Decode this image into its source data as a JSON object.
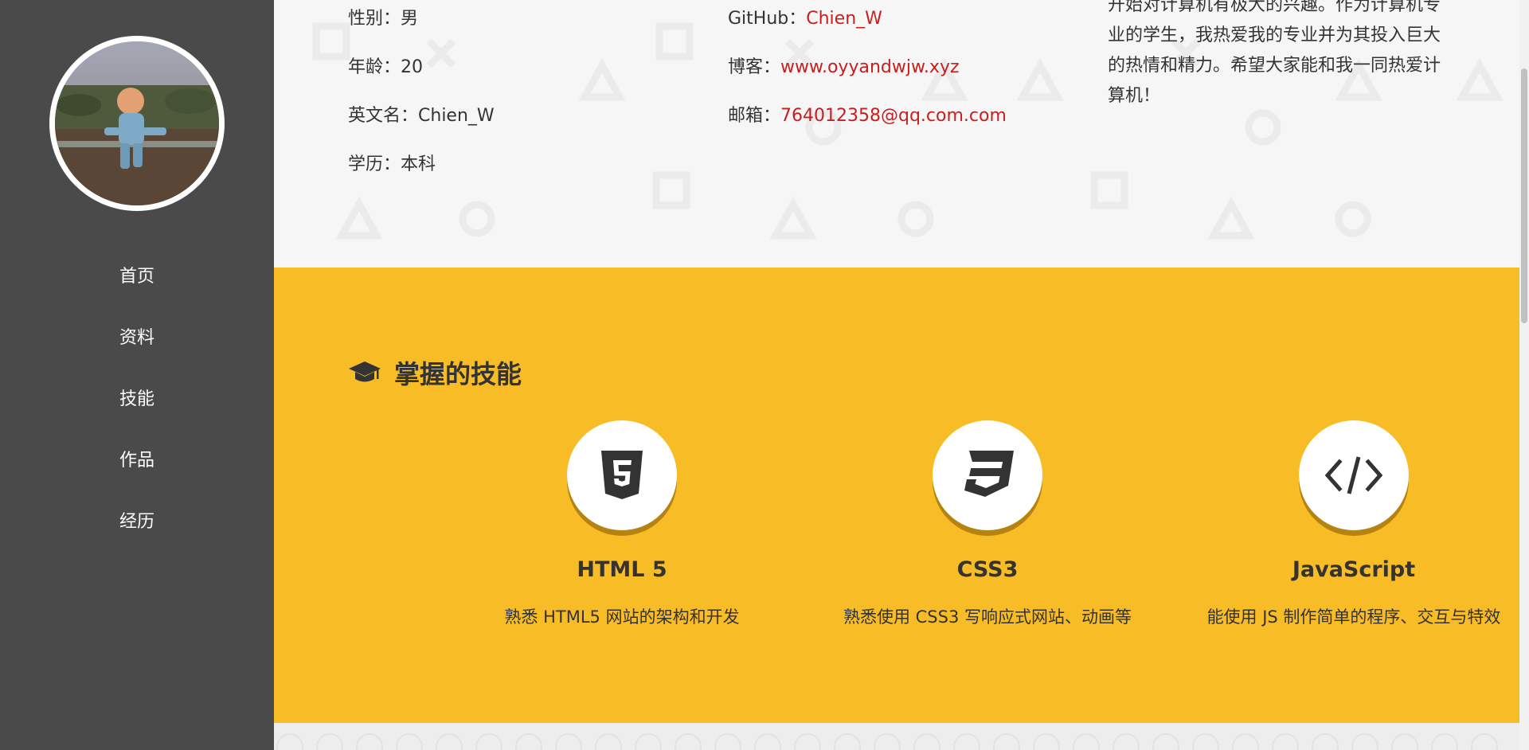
{
  "sidebar": {
    "nav": [
      {
        "label": "首页"
      },
      {
        "label": "资料"
      },
      {
        "label": "技能"
      },
      {
        "label": "作品"
      },
      {
        "label": "经历"
      }
    ]
  },
  "profile": {
    "left": [
      {
        "label": "性别：",
        "value": "男"
      },
      {
        "label": "年龄：",
        "value": "20"
      },
      {
        "label": "英文名：",
        "value": "Chien_W"
      },
      {
        "label": "学历：",
        "value": "本科"
      }
    ],
    "middle": [
      {
        "label": "GitHub：",
        "value": "Chien_W"
      },
      {
        "label": "博客：",
        "value": "www.oyyandwjw.xyz"
      },
      {
        "label": "邮箱：",
        "value": "764012358@qq.com.com"
      }
    ],
    "bio_lines": [
      "开始对计算机有极大的兴趣。作为计算机专",
      "业的学生，我热爱我的专业并为其投入巨大",
      "的热情和精力。希望大家能和我一同热爱计",
      "算机！"
    ]
  },
  "skills": {
    "title": "掌握的技能",
    "items": [
      {
        "name": "HTML 5",
        "desc": "熟悉 HTML5 网站的架构和开发",
        "icon": "html5-icon"
      },
      {
        "name": "CSS3",
        "desc": "熟悉使用 CSS3 写响应式网站、动画等",
        "icon": "css3-icon"
      },
      {
        "name": "JavaScript",
        "desc": "能使用 JS 制作简单的程序、交互与特效",
        "icon": "code-icon"
      }
    ]
  },
  "colors": {
    "sidebar": "#4a4a4a",
    "accent": "#f8bc27",
    "link": "#c81e1e",
    "text": "#333333"
  }
}
